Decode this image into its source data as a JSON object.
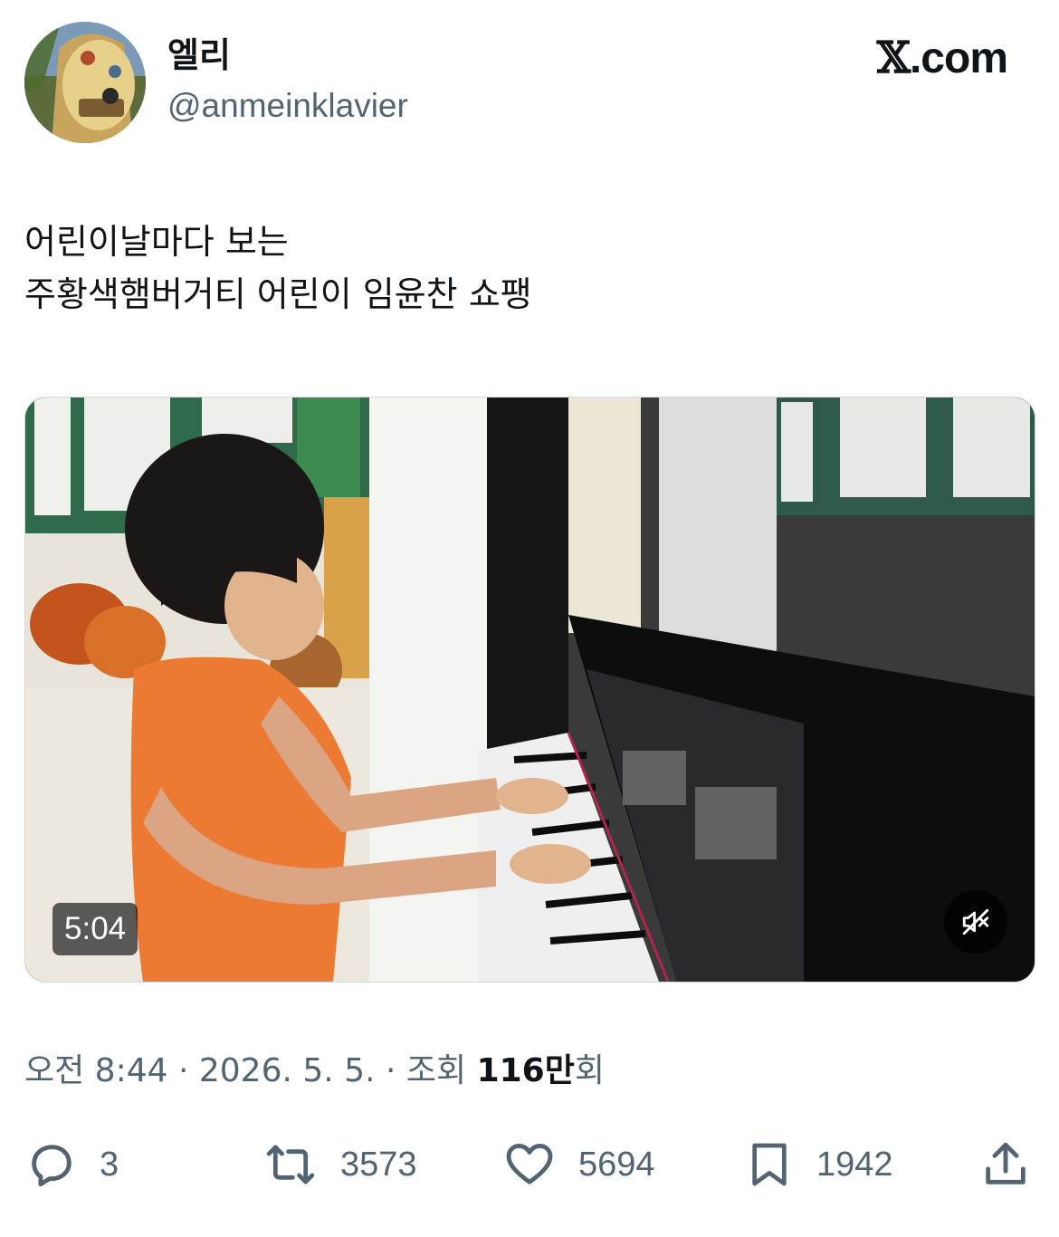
{
  "author": {
    "display_name": "엘리",
    "handle": "@anmeinklavier"
  },
  "brand": {
    "prefix": "𝕏",
    "suffix": ".com"
  },
  "tweet": {
    "lines": [
      "어린이날마다 보는",
      "주황색햄버거티 어린이 임윤찬 쇼팽"
    ]
  },
  "media": {
    "type": "video",
    "duration": "5:04",
    "mute_icon": "speaker-muted-icon"
  },
  "meta": {
    "time": "오전 8:44",
    "separator": " · ",
    "date": "2026. 5. 5.",
    "views_prefix": "조회 ",
    "views_number": "116만",
    "views_suffix": "회"
  },
  "actions": {
    "reply": {
      "icon": "reply-icon",
      "count": "3"
    },
    "repost": {
      "icon": "repost-icon",
      "count": "3573"
    },
    "like": {
      "icon": "heart-icon",
      "count": "5694"
    },
    "bookmark": {
      "icon": "bookmark-icon",
      "count": "1942"
    },
    "share": {
      "icon": "share-icon"
    }
  },
  "colors": {
    "text_primary": "#0f1419",
    "text_secondary": "#536471",
    "border": "#cfd9de"
  }
}
